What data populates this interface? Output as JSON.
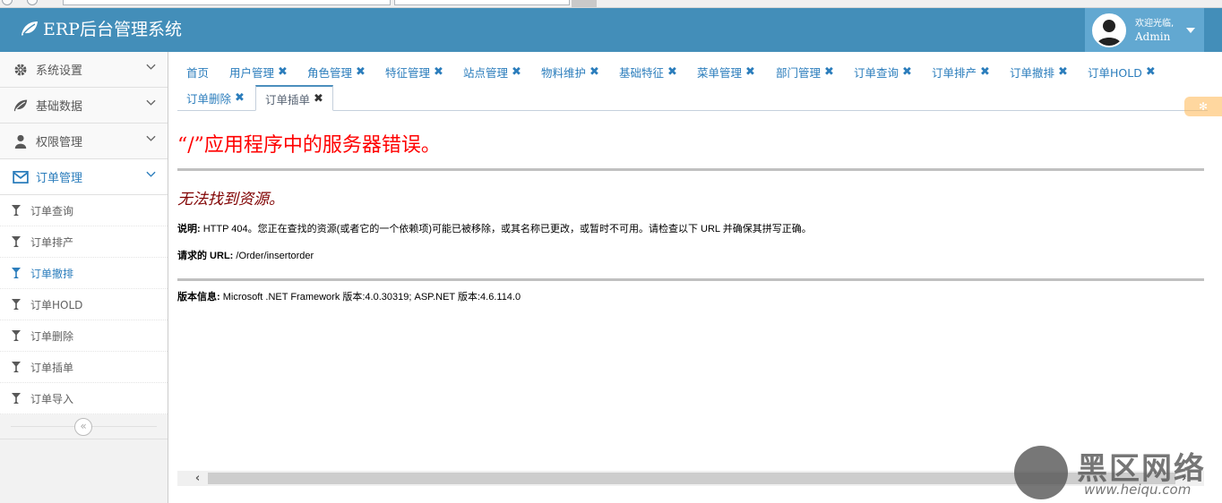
{
  "app": {
    "title": "ERP后台管理系统"
  },
  "user": {
    "welcome": "欢迎光临,",
    "name": "Admin"
  },
  "sidebar": {
    "menus": [
      {
        "label": "系统设置",
        "icon": "gear-icon"
      },
      {
        "label": "基础数据",
        "icon": "leaf-icon"
      },
      {
        "label": "权限管理",
        "icon": "user-icon"
      },
      {
        "label": "订单管理",
        "icon": "envelope-icon"
      }
    ],
    "submenu": [
      {
        "label": "订单查询"
      },
      {
        "label": "订单排产"
      },
      {
        "label": "订单撤排"
      },
      {
        "label": "订单HOLD"
      },
      {
        "label": "订单删除"
      },
      {
        "label": "订单插单"
      },
      {
        "label": "订单导入"
      }
    ],
    "active_submenu": "订单撤排"
  },
  "tabs": [
    {
      "label": "首页",
      "closable": false
    },
    {
      "label": "用户管理",
      "closable": true
    },
    {
      "label": "角色管理",
      "closable": true
    },
    {
      "label": "特征管理",
      "closable": true
    },
    {
      "label": "站点管理",
      "closable": true
    },
    {
      "label": "物料维护",
      "closable": true
    },
    {
      "label": "基础特征",
      "closable": true
    },
    {
      "label": "菜单管理",
      "closable": true
    },
    {
      "label": "部门管理",
      "closable": true
    },
    {
      "label": "订单查询",
      "closable": true
    },
    {
      "label": "订单排产",
      "closable": true
    },
    {
      "label": "订单撤排",
      "closable": true
    },
    {
      "label": "订单HOLD",
      "closable": true
    },
    {
      "label": "订单删除",
      "closable": true
    },
    {
      "label": "订单插单",
      "closable": true,
      "current": true
    }
  ],
  "error": {
    "title": "“/”应用程序中的服务器错误。",
    "subtitle": "无法找到资源。",
    "desc_label": "说明:",
    "desc_text": " HTTP 404。您正在查找的资源(或者它的一个依赖项)可能已被移除，或其名称已更改，或暂时不可用。请检查以下 URL 并确保其拼写正确。",
    "url_label": "请求的 URL:",
    "url_value": " /Order/insertorder",
    "version_label": "版本信息:",
    "version_text": " Microsoft .NET Framework 版本:4.0.30319; ASP.NET 版本:4.6.114.0"
  },
  "watermark": {
    "text": "黑区网络",
    "url": "www.heiqu.com"
  },
  "colors": {
    "header": "#438eb9",
    "user_box": "#62a8d1",
    "link": "#2b7dbc",
    "error_title": "#ff0000",
    "error_subtitle": "#800000"
  }
}
